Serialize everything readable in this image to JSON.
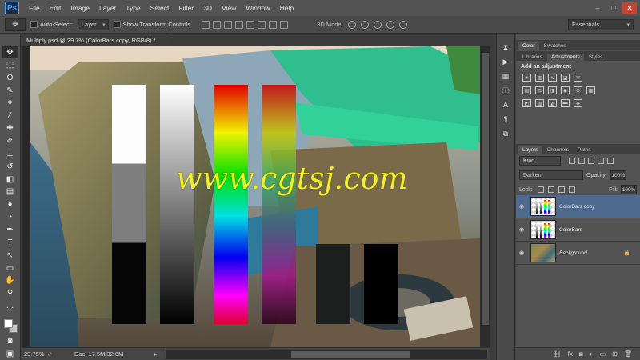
{
  "app": {
    "logo": "Ps"
  },
  "menu": [
    "File",
    "Edit",
    "Image",
    "Layer",
    "Type",
    "Select",
    "Filter",
    "3D",
    "View",
    "Window",
    "Help"
  ],
  "window_controls": {
    "minimize": "–",
    "maximize": "□",
    "close": "✕"
  },
  "options_bar": {
    "tool_icon": "move-tool-icon",
    "auto_select_label": "Auto-Select:",
    "auto_select_value": "Layer",
    "transform_label": "Show Transform Controls",
    "mode3d_label": "3D Mode:",
    "workspace": "Essentials"
  },
  "document": {
    "tab_title": "Multiply.psd @ 29.7% (ColorBars copy, RGB/8) *",
    "zoom": "29.75%",
    "doc_info": "Doc: 17.5M/32.6M"
  },
  "watermark": "www.cgtsj.com",
  "panels": {
    "color_tabs": [
      "Color",
      "Swatches"
    ],
    "adjust_tabs": [
      "Libraries",
      "Adjustments",
      "Styles"
    ],
    "adjust_title": "Add an adjustment",
    "layers_tabs": [
      "Layers",
      "Channels",
      "Paths"
    ],
    "kind": "Kind",
    "blend_mode": "Darken",
    "opacity_label": "Opacity:",
    "opacity_value": "100%",
    "lock_label": "Lock:",
    "fill_label": "Fill:",
    "fill_value": "100%",
    "layers": [
      {
        "name": "ColorBars copy",
        "selected": true
      },
      {
        "name": "ColorBars",
        "selected": false
      },
      {
        "name": "Background",
        "selected": false
      }
    ]
  },
  "colors": {
    "accent": "#4e6a8e",
    "watermark": "#f2f21a",
    "close": "#c7432f"
  }
}
